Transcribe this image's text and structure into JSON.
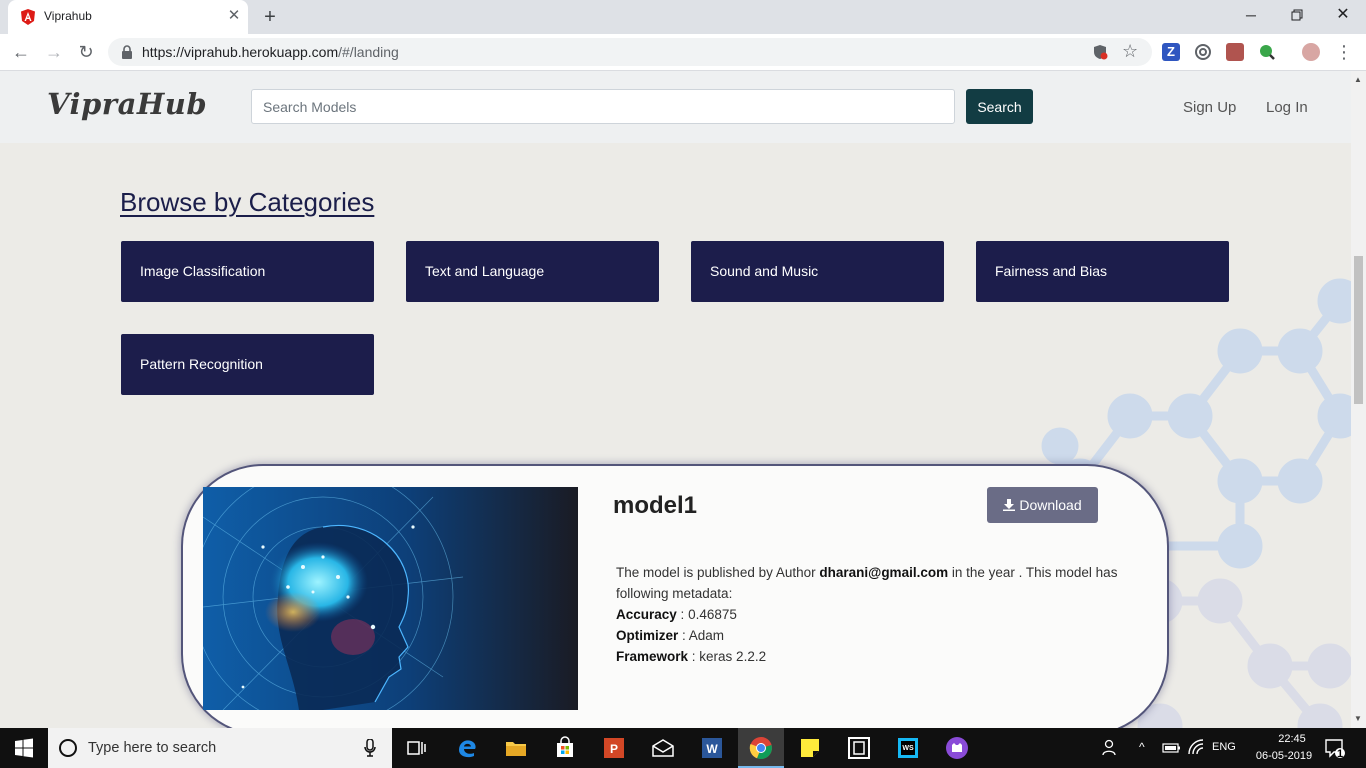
{
  "browser": {
    "tab_title": "Viprahub",
    "url_host": "https://viprahub.herokuapp.com",
    "url_path": "/#/landing"
  },
  "header": {
    "logo": "VipraHub",
    "search_placeholder": "Search Models",
    "search_button": "Search",
    "sign_up": "Sign Up",
    "log_in": "Log In"
  },
  "categories": {
    "title": "Browse by Categories",
    "items": [
      "Image Classification",
      "Text and Language",
      "Sound and Music",
      "Fairness and Bias",
      "Pattern Recognition"
    ]
  },
  "model_card": {
    "name": "model1",
    "download_label": "Download",
    "description_prefix": "The model is published by Author",
    "author": "dharani@gmail.com",
    "description_suffix": "in the year . This model has following metadata:",
    "metadata": [
      {
        "key": "Accuracy",
        "sep": " : ",
        "value": "0.46875"
      },
      {
        "key": "Optimizer",
        "sep": " : ",
        "value": "Adam"
      },
      {
        "key": "Framework",
        "sep": " : ",
        "value": "keras 2.2.2"
      }
    ]
  },
  "taskbar": {
    "search_placeholder": "Type here to search",
    "language": "ENG",
    "time": "22:45",
    "date": "06-05-2019",
    "notification_count": "1"
  },
  "colors": {
    "category_bg": "#1c1d4b",
    "search_button_bg": "#123c43",
    "download_bg": "#6a6c86"
  }
}
